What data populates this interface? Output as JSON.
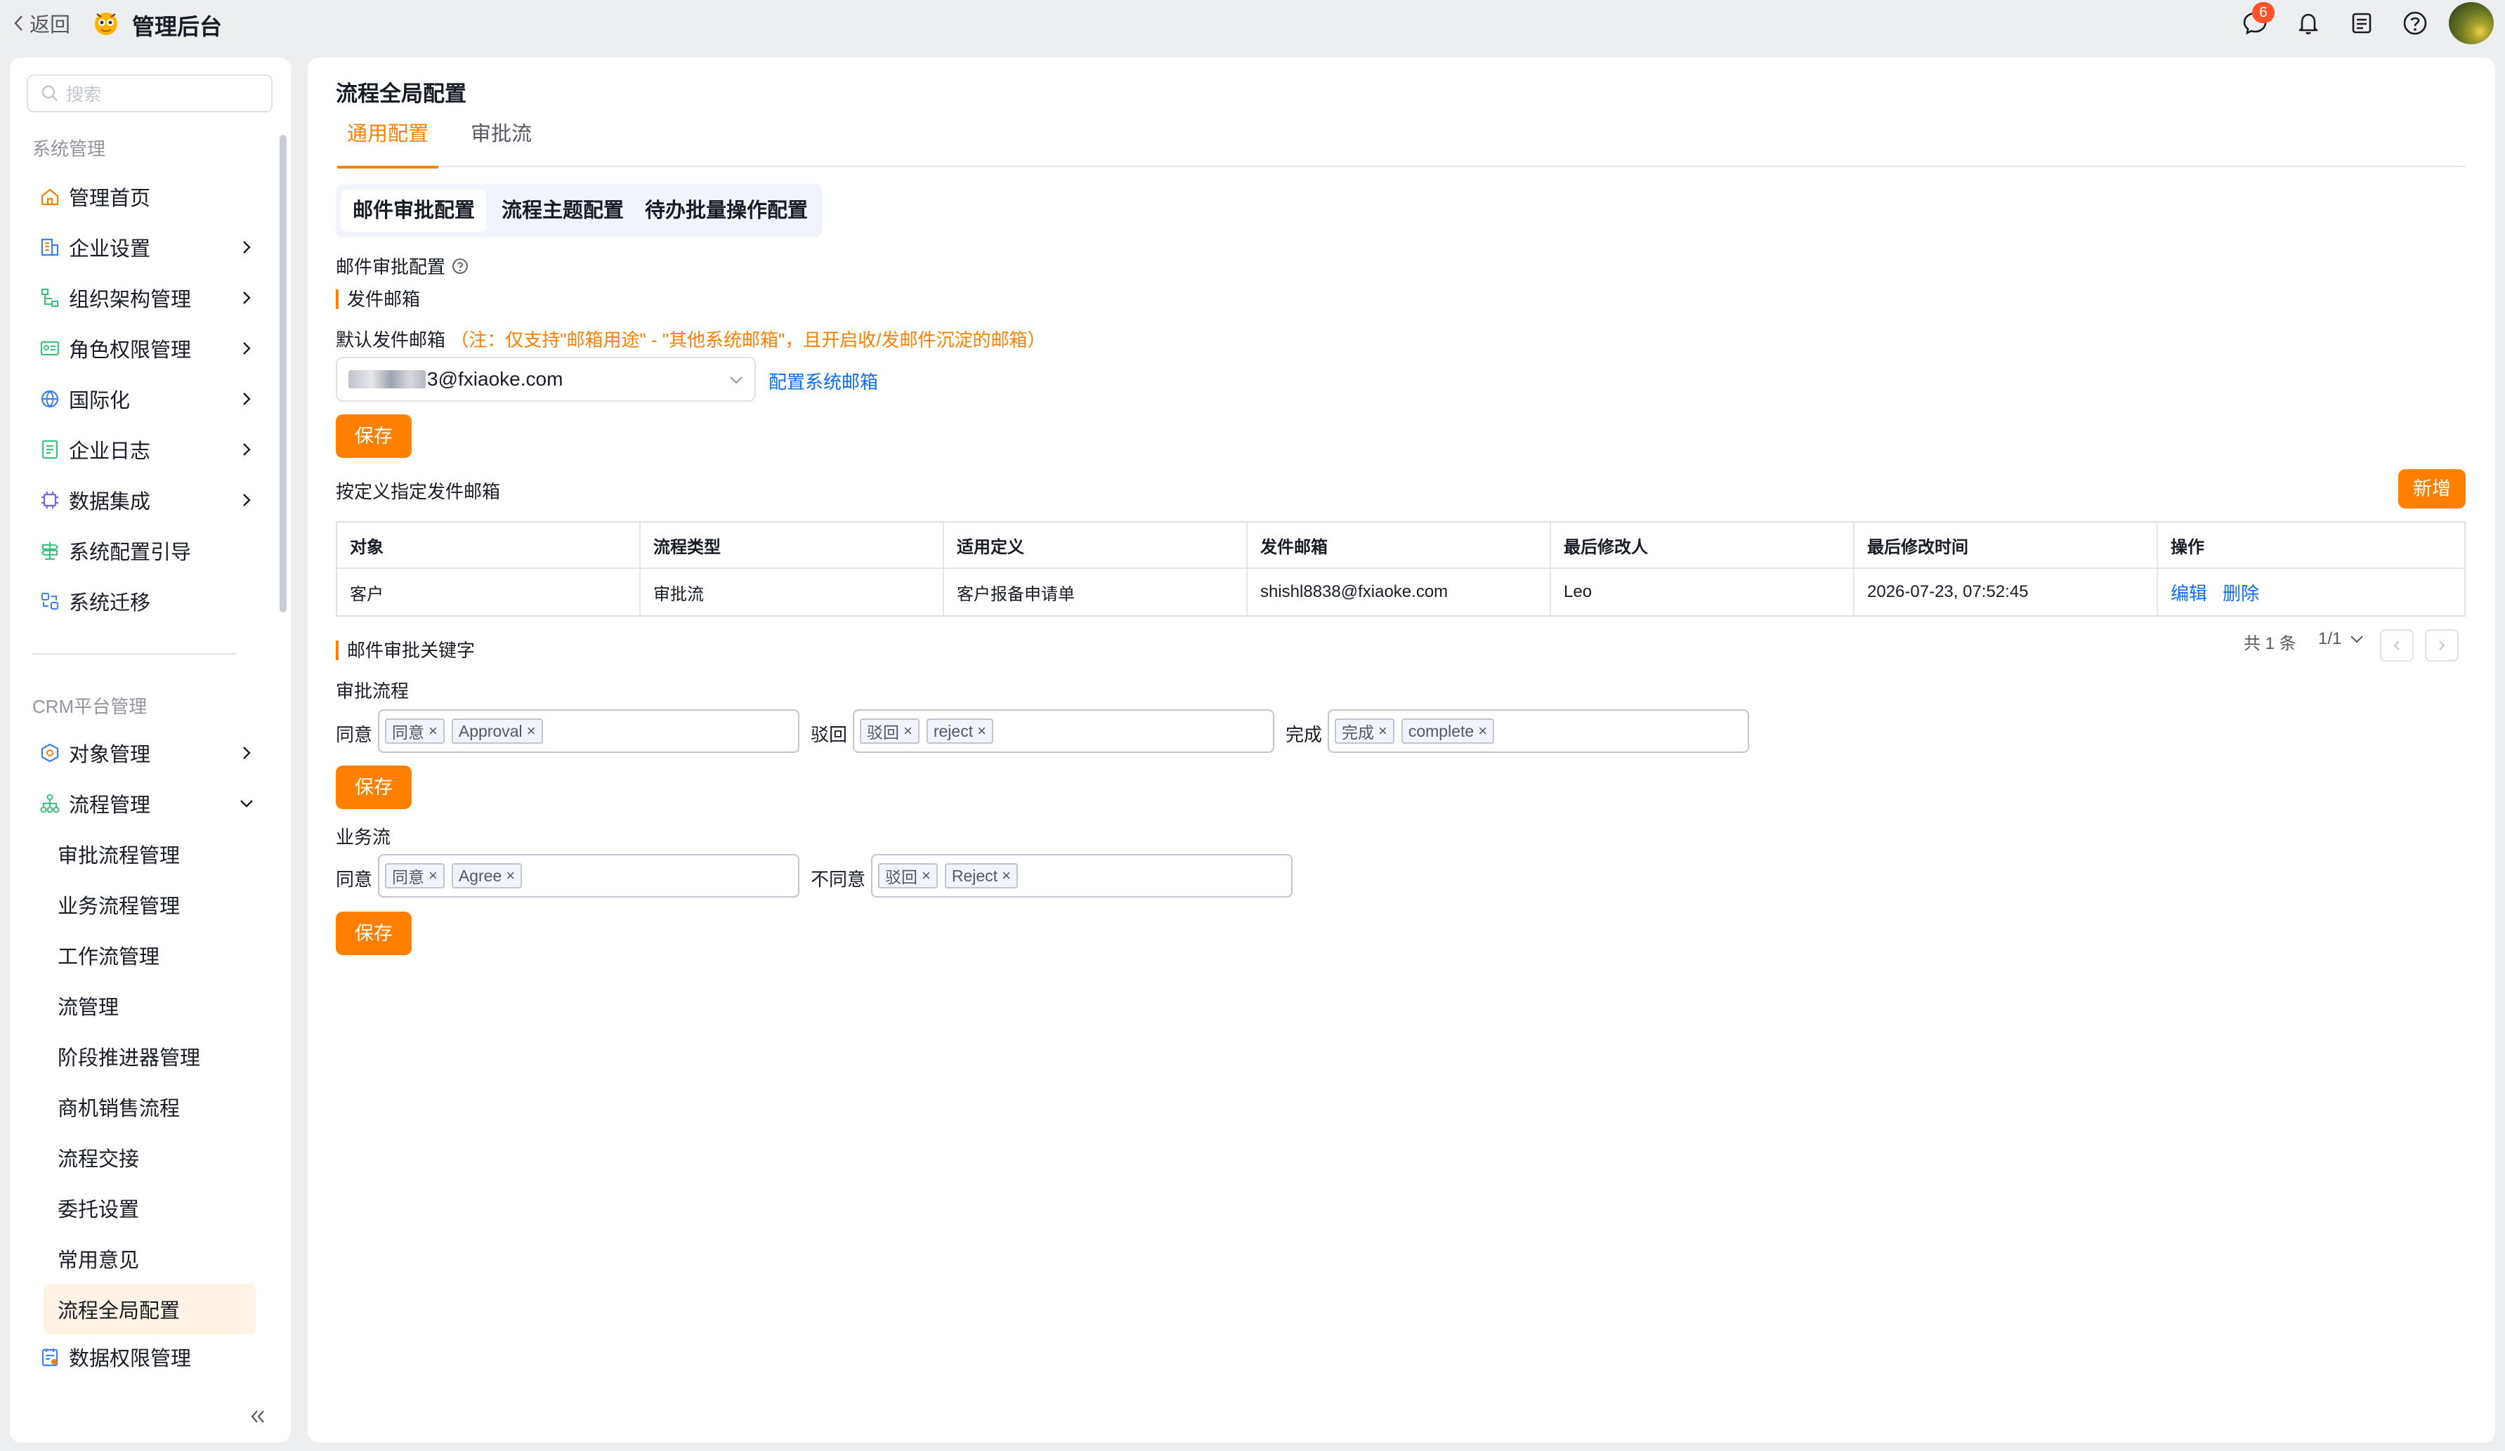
{
  "topbar": {
    "back_label": "返回",
    "app_title": "管理后台",
    "notification_badge": "6",
    "icons": [
      "message-icon",
      "bell-icon",
      "document-icon",
      "help-icon",
      "avatar"
    ]
  },
  "sidebar": {
    "search_placeholder": "搜索",
    "group1": "系统管理",
    "items": [
      {
        "label": "管理首页",
        "icon": "home-icon",
        "expandable": false
      },
      {
        "label": "企业设置",
        "icon": "building-icon",
        "expandable": true
      },
      {
        "label": "组织架构管理",
        "icon": "org-tree-icon",
        "expandable": true
      },
      {
        "label": "角色权限管理",
        "icon": "id-card-icon",
        "expandable": true
      },
      {
        "label": "国际化",
        "icon": "globe-icon",
        "expandable": true
      },
      {
        "label": "企业日志",
        "icon": "log-icon",
        "expandable": true
      },
      {
        "label": "数据集成",
        "icon": "chip-icon",
        "expandable": true
      },
      {
        "label": "系统配置引导",
        "icon": "signpost-icon",
        "expandable": false
      },
      {
        "label": "系统迁移",
        "icon": "migrate-icon",
        "expandable": false
      }
    ],
    "group2": "CRM平台管理",
    "crm_items": [
      {
        "label": "对象管理",
        "icon": "object-icon",
        "expandable": true
      },
      {
        "label": "流程管理",
        "icon": "flow-icon",
        "expanded": true
      }
    ],
    "flow_sub_items": [
      "审批流程管理",
      "业务流程管理",
      "工作流管理",
      "流管理",
      "阶段推进器管理",
      "商机销售流程",
      "流程交接",
      "委托设置",
      "常用意见",
      "流程全局配置"
    ],
    "active_sub_item": "流程全局配置",
    "last_item": {
      "label": "数据权限管理",
      "icon": "data-permission-icon"
    }
  },
  "main": {
    "page_title": "流程全局配置",
    "tabs": [
      "通用配置",
      "审批流"
    ],
    "active_tab": "通用配置",
    "segments": [
      "邮件审批配置",
      "流程主题配置",
      "待办批量操作配置"
    ],
    "active_segment": "邮件审批配置",
    "section_title": "邮件审批配置",
    "sender_section": "发件邮箱",
    "default_sender_label": "默认发件邮箱",
    "default_sender_note": "（注：仅支持\"邮箱用途\" - \"其他系统邮箱\"，且开启收/发邮件沉淀的邮箱）",
    "default_sender_value": "3@fxiaoke.com",
    "config_link": "配置系统邮箱",
    "save_label": "保存",
    "custom_sender_label": "按定义指定发件邮箱",
    "add_label": "新增",
    "table": {
      "columns": [
        "对象",
        "流程类型",
        "适用定义",
        "发件邮箱",
        "最后修改人",
        "最后修改时间",
        "操作"
      ],
      "rows": [
        {
          "cells": [
            "客户",
            "审批流",
            "客户报备申请单",
            "shishl8838@fxiaoke.com",
            "Leo",
            "2026-07-23, 07:52:45"
          ],
          "actions": [
            "编辑",
            "删除"
          ]
        }
      ]
    },
    "pagination": {
      "total": "共 1 条",
      "page": "1/1"
    },
    "keyword_section": "邮件审批关键字",
    "approval_flow": {
      "title": "审批流程",
      "agree_label": "同意",
      "agree_tags": [
        "同意",
        "Approval"
      ],
      "reject_label": "驳回",
      "reject_tags": [
        "驳回",
        "reject"
      ],
      "complete_label": "完成",
      "complete_tags": [
        "完成",
        "complete"
      ]
    },
    "business_flow": {
      "title": "业务流",
      "agree_label": "同意",
      "agree_tags": [
        "同意",
        "Agree"
      ],
      "disagree_label": "不同意",
      "disagree_tags": [
        "驳回",
        "Reject"
      ]
    }
  }
}
